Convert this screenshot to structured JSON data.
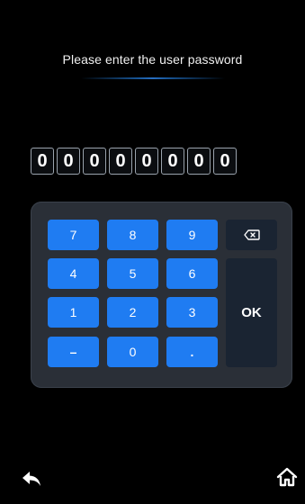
{
  "prompt": "Please enter the user password",
  "password_digits": [
    "0",
    "0",
    "0",
    "0",
    "0",
    "0",
    "0",
    "0"
  ],
  "keypad": {
    "k7": "7",
    "k8": "8",
    "k9": "9",
    "k4": "4",
    "k5": "5",
    "k6": "6",
    "k1": "1",
    "k2": "2",
    "k3": "3",
    "minus": "–",
    "k0": "0",
    "dot": ".",
    "ok": "OK",
    "backspace_icon": "backspace-icon"
  },
  "nav": {
    "back_icon": "back-arrow-icon",
    "home_icon": "home-icon"
  },
  "colors": {
    "key_blue": "#1f7cf2",
    "keypad_bg": "#2a2f37",
    "key_dark": "#1a2432",
    "accent_line": "#2c7ad6"
  }
}
